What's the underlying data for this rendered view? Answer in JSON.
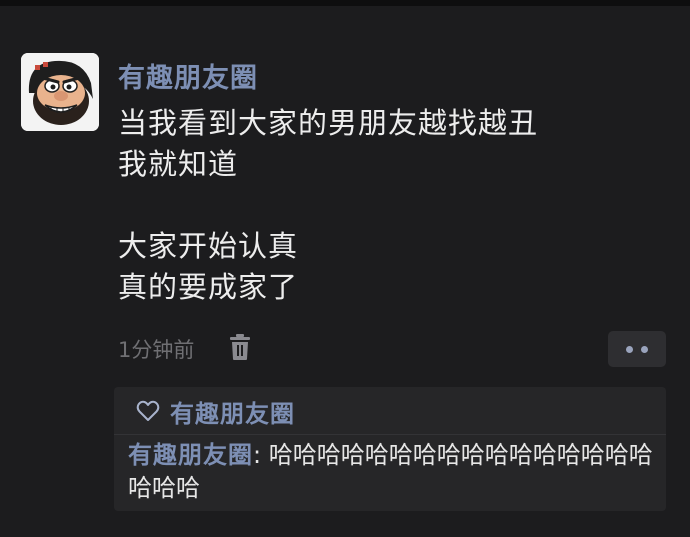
{
  "post": {
    "username": "有趣朋友圈",
    "content_lines": [
      "当我看到大家的男朋友越找越丑",
      "我就知道",
      "",
      "大家开始认真",
      "真的要成家了"
    ],
    "time": "1分钟前"
  },
  "likes": {
    "names": [
      "有趣朋友圈"
    ]
  },
  "comments": [
    {
      "author": "有趣朋友圈",
      "separator": ": ",
      "text": "哈哈哈哈哈哈哈哈哈哈哈哈哈哈哈哈哈哈哈"
    }
  ],
  "icons": {
    "delete": "trash-icon",
    "like": "heart-outline-icon",
    "more": "more-dots-icon"
  },
  "colors": {
    "background": "#1c1c1e",
    "name_link": "#7d8fb4",
    "secondary_text": "#6f6f73",
    "likes_box": "#262628"
  }
}
